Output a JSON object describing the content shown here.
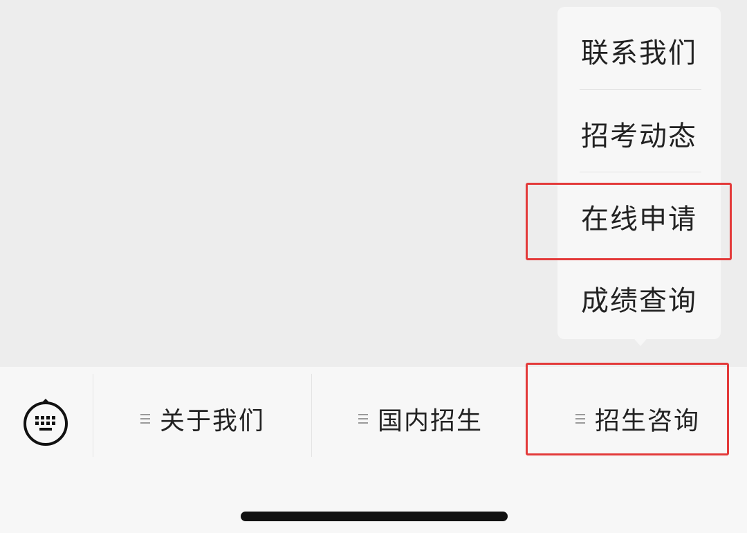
{
  "popup_menu": {
    "items": [
      {
        "label": "联系我们"
      },
      {
        "label": "招考动态"
      },
      {
        "label": "在线申请"
      },
      {
        "label": "成绩查询"
      }
    ]
  },
  "menu_bar": {
    "keyboard_icon": "keyboard-icon",
    "tabs": [
      {
        "label": "关于我们",
        "icon": "menu-lines-icon"
      },
      {
        "label": "国内招生",
        "icon": "menu-lines-icon"
      },
      {
        "label": "招生咨询",
        "icon": "menu-lines-icon"
      }
    ]
  },
  "colors": {
    "highlight": "#e33a3a",
    "background": "#ededed",
    "menu_background": "#f7f7f7",
    "text": "#222222"
  }
}
